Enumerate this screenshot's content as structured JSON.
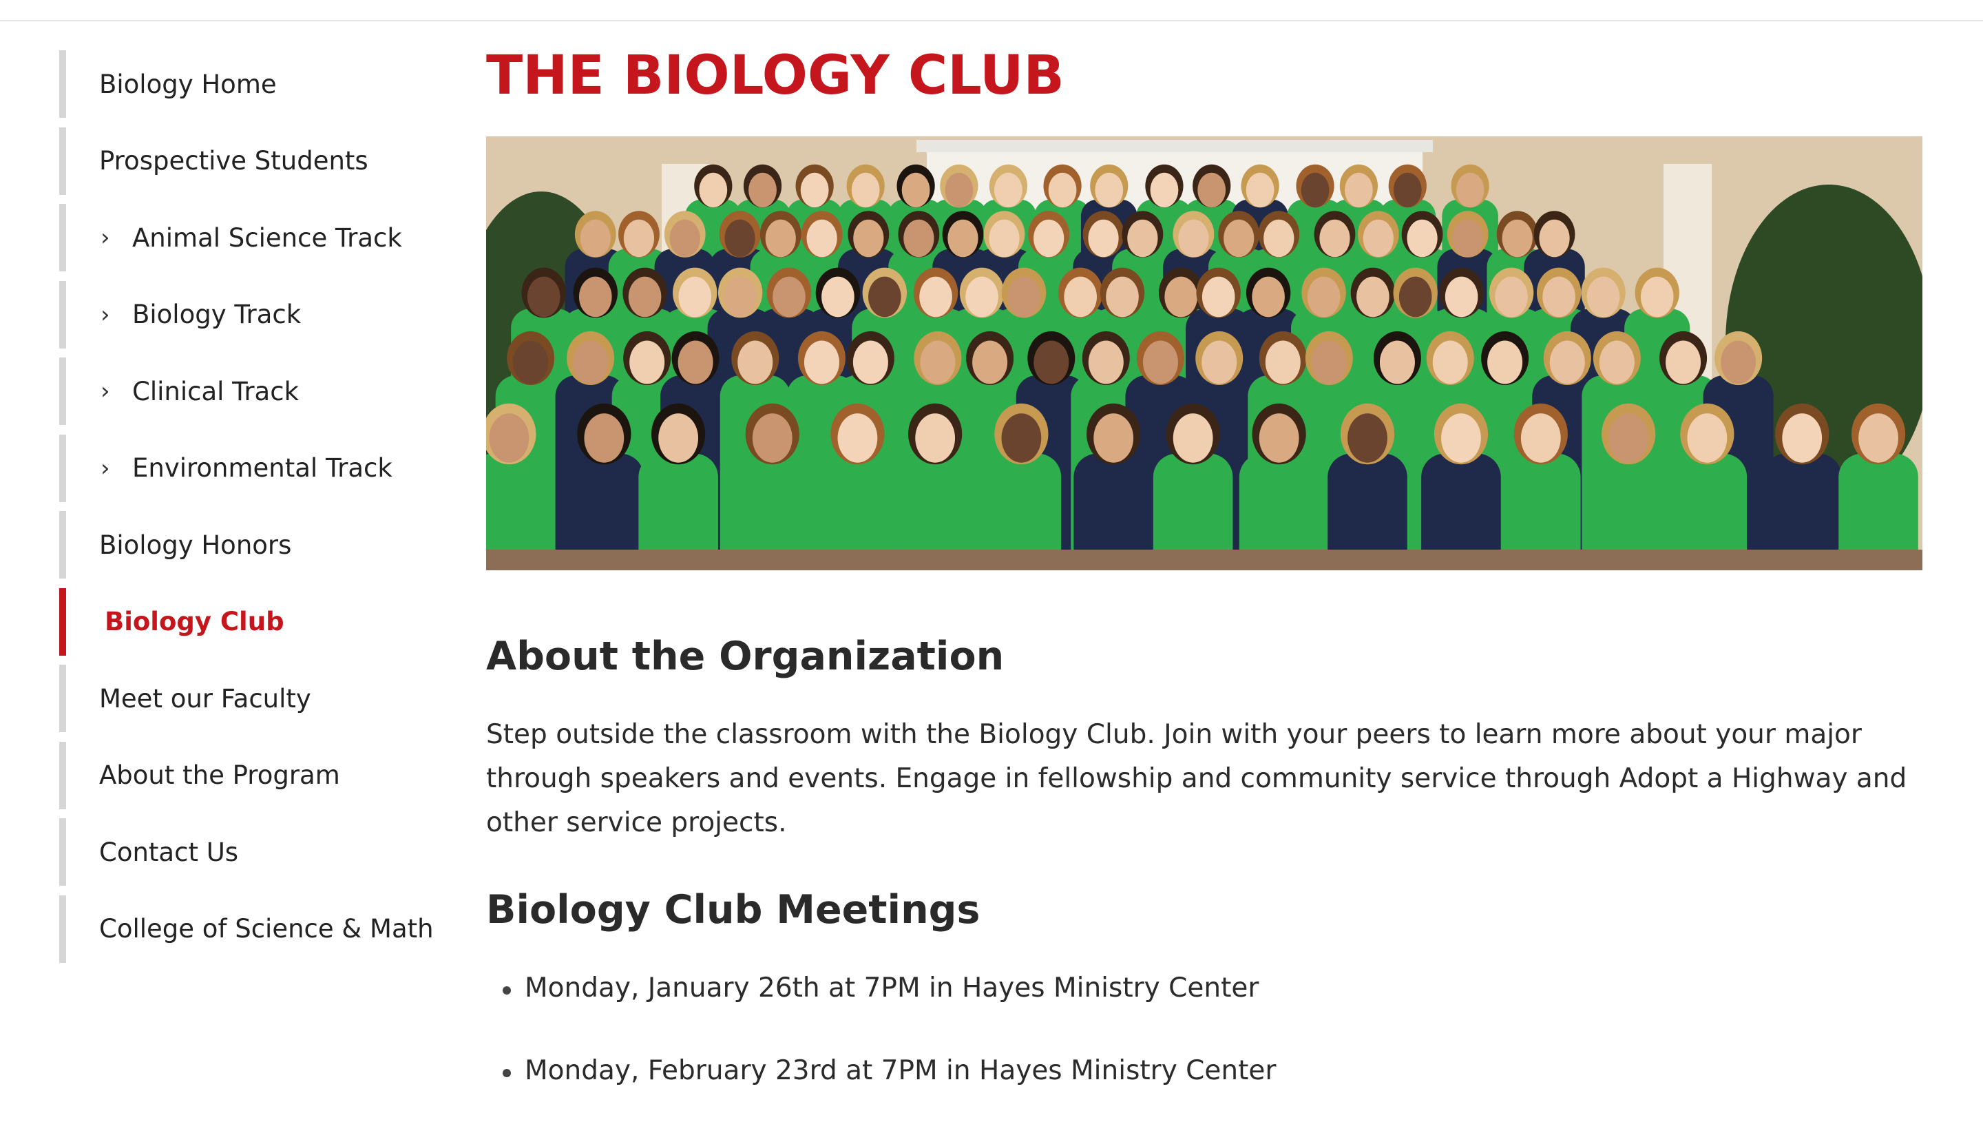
{
  "sidebar": {
    "items": [
      {
        "label": "Biology Home",
        "sub": false,
        "active": false
      },
      {
        "label": "Prospective Students",
        "sub": false,
        "active": false
      },
      {
        "label": "Animal Science Track",
        "sub": true,
        "active": false
      },
      {
        "label": "Biology Track",
        "sub": true,
        "active": false
      },
      {
        "label": "Clinical Track",
        "sub": true,
        "active": false
      },
      {
        "label": "Environmental Track",
        "sub": true,
        "active": false
      },
      {
        "label": "Biology Honors",
        "sub": false,
        "active": false
      },
      {
        "label": "Biology Club",
        "sub": false,
        "active": true
      },
      {
        "label": "Meet our Faculty",
        "sub": false,
        "active": false
      },
      {
        "label": "About the Program",
        "sub": false,
        "active": false
      },
      {
        "label": "Contact Us",
        "sub": false,
        "active": false
      },
      {
        "label": "College of Science & Math",
        "sub": false,
        "active": false
      }
    ],
    "chevron": "›"
  },
  "main": {
    "title": "THE BIOLOGY CLUB",
    "about_heading": "About the Organization",
    "about_text": "Step outside the classroom with the Biology Club. Join with your peers to learn more about your major through speakers and events. Engage in fellowship and community service through Adopt a Highway and other service projects.",
    "meetings_heading": "Biology Club Meetings",
    "meetings": [
      "Monday, January 26th at 7PM in Hayes Ministry Center",
      "Monday, February 23rd at 7PM in Hayes Ministry Center"
    ]
  },
  "colors": {
    "accent": "#c4161c",
    "sidebar_border": "#d6d6d6",
    "shirt_green": "#2fae4e",
    "shirt_navy": "#1f2a4a"
  },
  "icons": {
    "chevron": "chevron-right-icon",
    "bullet": "bullet-icon"
  }
}
